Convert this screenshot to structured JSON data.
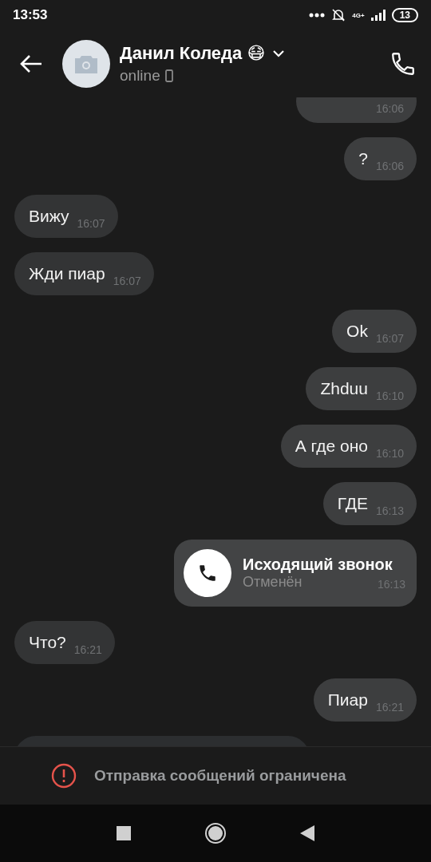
{
  "status_bar": {
    "time": "13:53",
    "network": "4G+",
    "battery": "13"
  },
  "header": {
    "name": "Данил Коледа 😷",
    "status": "online"
  },
  "messages": [
    {
      "outgoing": true,
      "kind": "text",
      "time": "16:06"
    },
    {
      "outgoing": true,
      "kind": "text",
      "text": "?",
      "time": "16:06"
    },
    {
      "outgoing": false,
      "kind": "text",
      "text": "Вижу",
      "time": "16:07"
    },
    {
      "outgoing": false,
      "kind": "text",
      "text": "Жди пиар",
      "time": "16:07"
    },
    {
      "outgoing": true,
      "kind": "text",
      "text": "Ok",
      "time": "16:07"
    },
    {
      "outgoing": true,
      "kind": "text",
      "text": "Zhduu",
      "time": "16:10"
    },
    {
      "outgoing": true,
      "kind": "text",
      "text": "А где оно",
      "time": "16:10"
    },
    {
      "outgoing": true,
      "kind": "text",
      "text": "ГДЕ",
      "time": "16:13"
    },
    {
      "outgoing": true,
      "kind": "call",
      "title": "Исходящий звонок",
      "subtitle": "Отменён",
      "time": "16:13"
    },
    {
      "outgoing": false,
      "kind": "text",
      "text": "Что?",
      "time": "16:21"
    },
    {
      "outgoing": true,
      "kind": "text",
      "text": "Пиар",
      "time": "16:21"
    },
    {
      "outgoing": false,
      "kind": "cut"
    }
  ],
  "notice": "Отправка сообщений ограничена"
}
